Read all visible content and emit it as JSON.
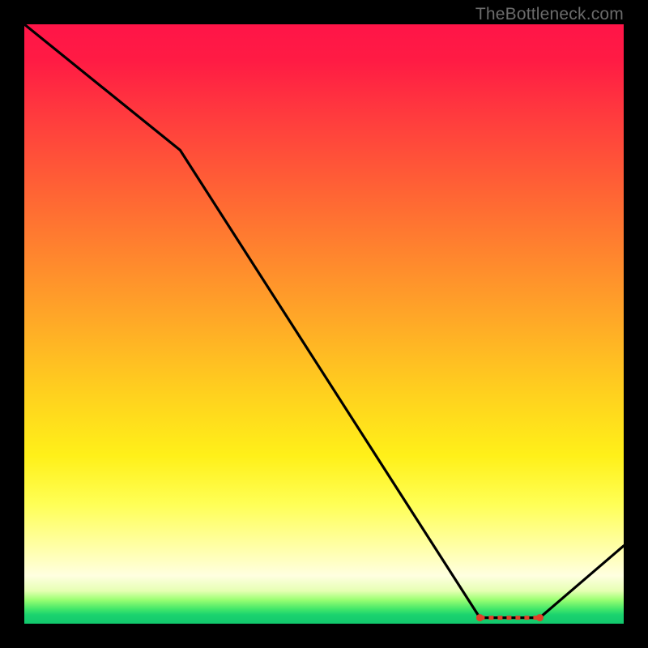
{
  "watermark": "TheBottleneck.com",
  "chart_data": {
    "type": "line",
    "title": "",
    "xlabel": "",
    "ylabel": "",
    "xlim": [
      0,
      100
    ],
    "ylim": [
      0,
      100
    ],
    "series": [
      {
        "name": "curve",
        "x": [
          0,
          26,
          76,
          86,
          100
        ],
        "values": [
          100,
          79,
          1,
          1,
          13
        ]
      }
    ],
    "marker_band": {
      "x_start": 76,
      "x_end": 86,
      "y": 1,
      "color": "#e04028"
    }
  }
}
